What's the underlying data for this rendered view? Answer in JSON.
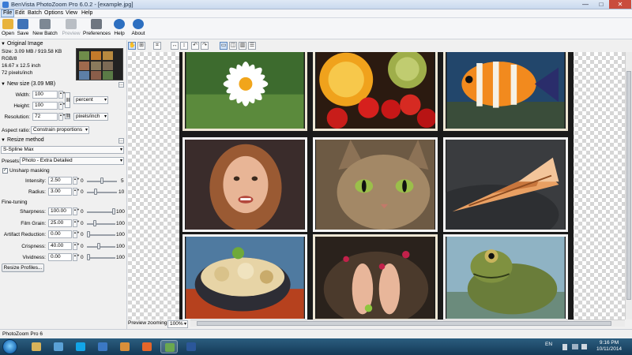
{
  "window": {
    "title": "BenVista PhotoZoom Pro 6.0.2 - [example.jpg]",
    "buttons": [
      "—",
      "□",
      "✕"
    ]
  },
  "menu": [
    "File",
    "Edit",
    "Batch",
    "Options",
    "View",
    "Help"
  ],
  "toolbar": [
    {
      "label": "Open",
      "icon": "folder-open-icon",
      "color": "#e8b33c"
    },
    {
      "label": "Save",
      "icon": "floppy-disk-icon",
      "color": "#3f73b8"
    },
    {
      "label": "New Batch",
      "icon": "batch-stack-icon",
      "color": "#7d8894"
    },
    {
      "label": "Preview",
      "icon": "printer-preview-icon",
      "color": "#b9bec4",
      "disabled": true
    },
    {
      "label": "Preferences",
      "icon": "tools-icon",
      "color": "#6e7680"
    },
    {
      "label": "Help",
      "icon": "help-icon",
      "color": "#2d6fc0"
    },
    {
      "label": "About",
      "icon": "info-icon",
      "color": "#2d6fc0"
    }
  ],
  "panel": {
    "original": {
      "title": "Original Image",
      "size": "Size: 3.09 MB / 919.58 KB",
      "mode": "RGB/8",
      "dimensions": "16.67 x 12.5 inch",
      "resolution": "72 pixels/inch"
    },
    "new_size": {
      "title": "New size (3.09 MB)",
      "width_label": "Width:",
      "width_value": "100",
      "height_label": "Height:",
      "height_value": "100",
      "resolution_label": "Resolution:",
      "resolution_value": "72",
      "unit": "percent",
      "res_unit": "pixels/inch",
      "aspect_label": "Aspect ratio:",
      "aspect_value": "Constrain proportions"
    },
    "resize": {
      "title": "Resize method",
      "method": "S-Spline Max",
      "presets_label": "Presets:",
      "preset": "Photo - Extra Detailed"
    },
    "unsharp": {
      "label": "Unsharp masking",
      "checked": true,
      "intensity_label": "Intensity:",
      "intensity_value": "2.50",
      "intensity_min": "0",
      "intensity_max": "5",
      "radius_label": "Radius:",
      "radius_value": "3.00",
      "radius_min": "0",
      "radius_max": "10"
    },
    "finetune": {
      "title": "Fine-tuning",
      "rows": [
        {
          "label": "Sharpness:",
          "value": "100.00",
          "min": "0",
          "max": "100",
          "level": 1.0
        },
        {
          "label": "Film Grain:",
          "value": "25.00",
          "min": "0",
          "max": "100",
          "level": 0.25
        },
        {
          "label": "Artifact Reduction:",
          "value": "0.00",
          "min": "0",
          "max": "100",
          "level": 0.0
        },
        {
          "label": "Crispness:",
          "value": "40.00",
          "min": "0",
          "max": "100",
          "level": 0.4
        },
        {
          "label": "Vividness:",
          "value": "0.00",
          "min": "0",
          "max": "100",
          "level": 0.0
        }
      ]
    },
    "resize_profiles": "Resize Profiles..."
  },
  "preview": {
    "zoom_label": "Preview zooming:",
    "zoom_value": "100%"
  },
  "status": "PhotoZoom Pro 6",
  "taskbar": {
    "apps": [
      {
        "icon": "windows-explorer-icon",
        "color": "#d7b35a"
      },
      {
        "icon": "network-icon",
        "color": "#5aa1d6"
      },
      {
        "icon": "skype-icon",
        "color": "#12a5e8"
      },
      {
        "icon": "outlook-icon",
        "color": "#3b78c4"
      },
      {
        "icon": "paint-icon",
        "color": "#d98f3a"
      },
      {
        "icon": "firefox-icon",
        "color": "#e5662a"
      },
      {
        "icon": "photozoom-icon",
        "color": "#6aa84f",
        "active": true
      },
      {
        "icon": "word-icon",
        "color": "#2b579a"
      }
    ],
    "language": "EN",
    "time": "9:16 PM",
    "date": "10/11/2014"
  }
}
